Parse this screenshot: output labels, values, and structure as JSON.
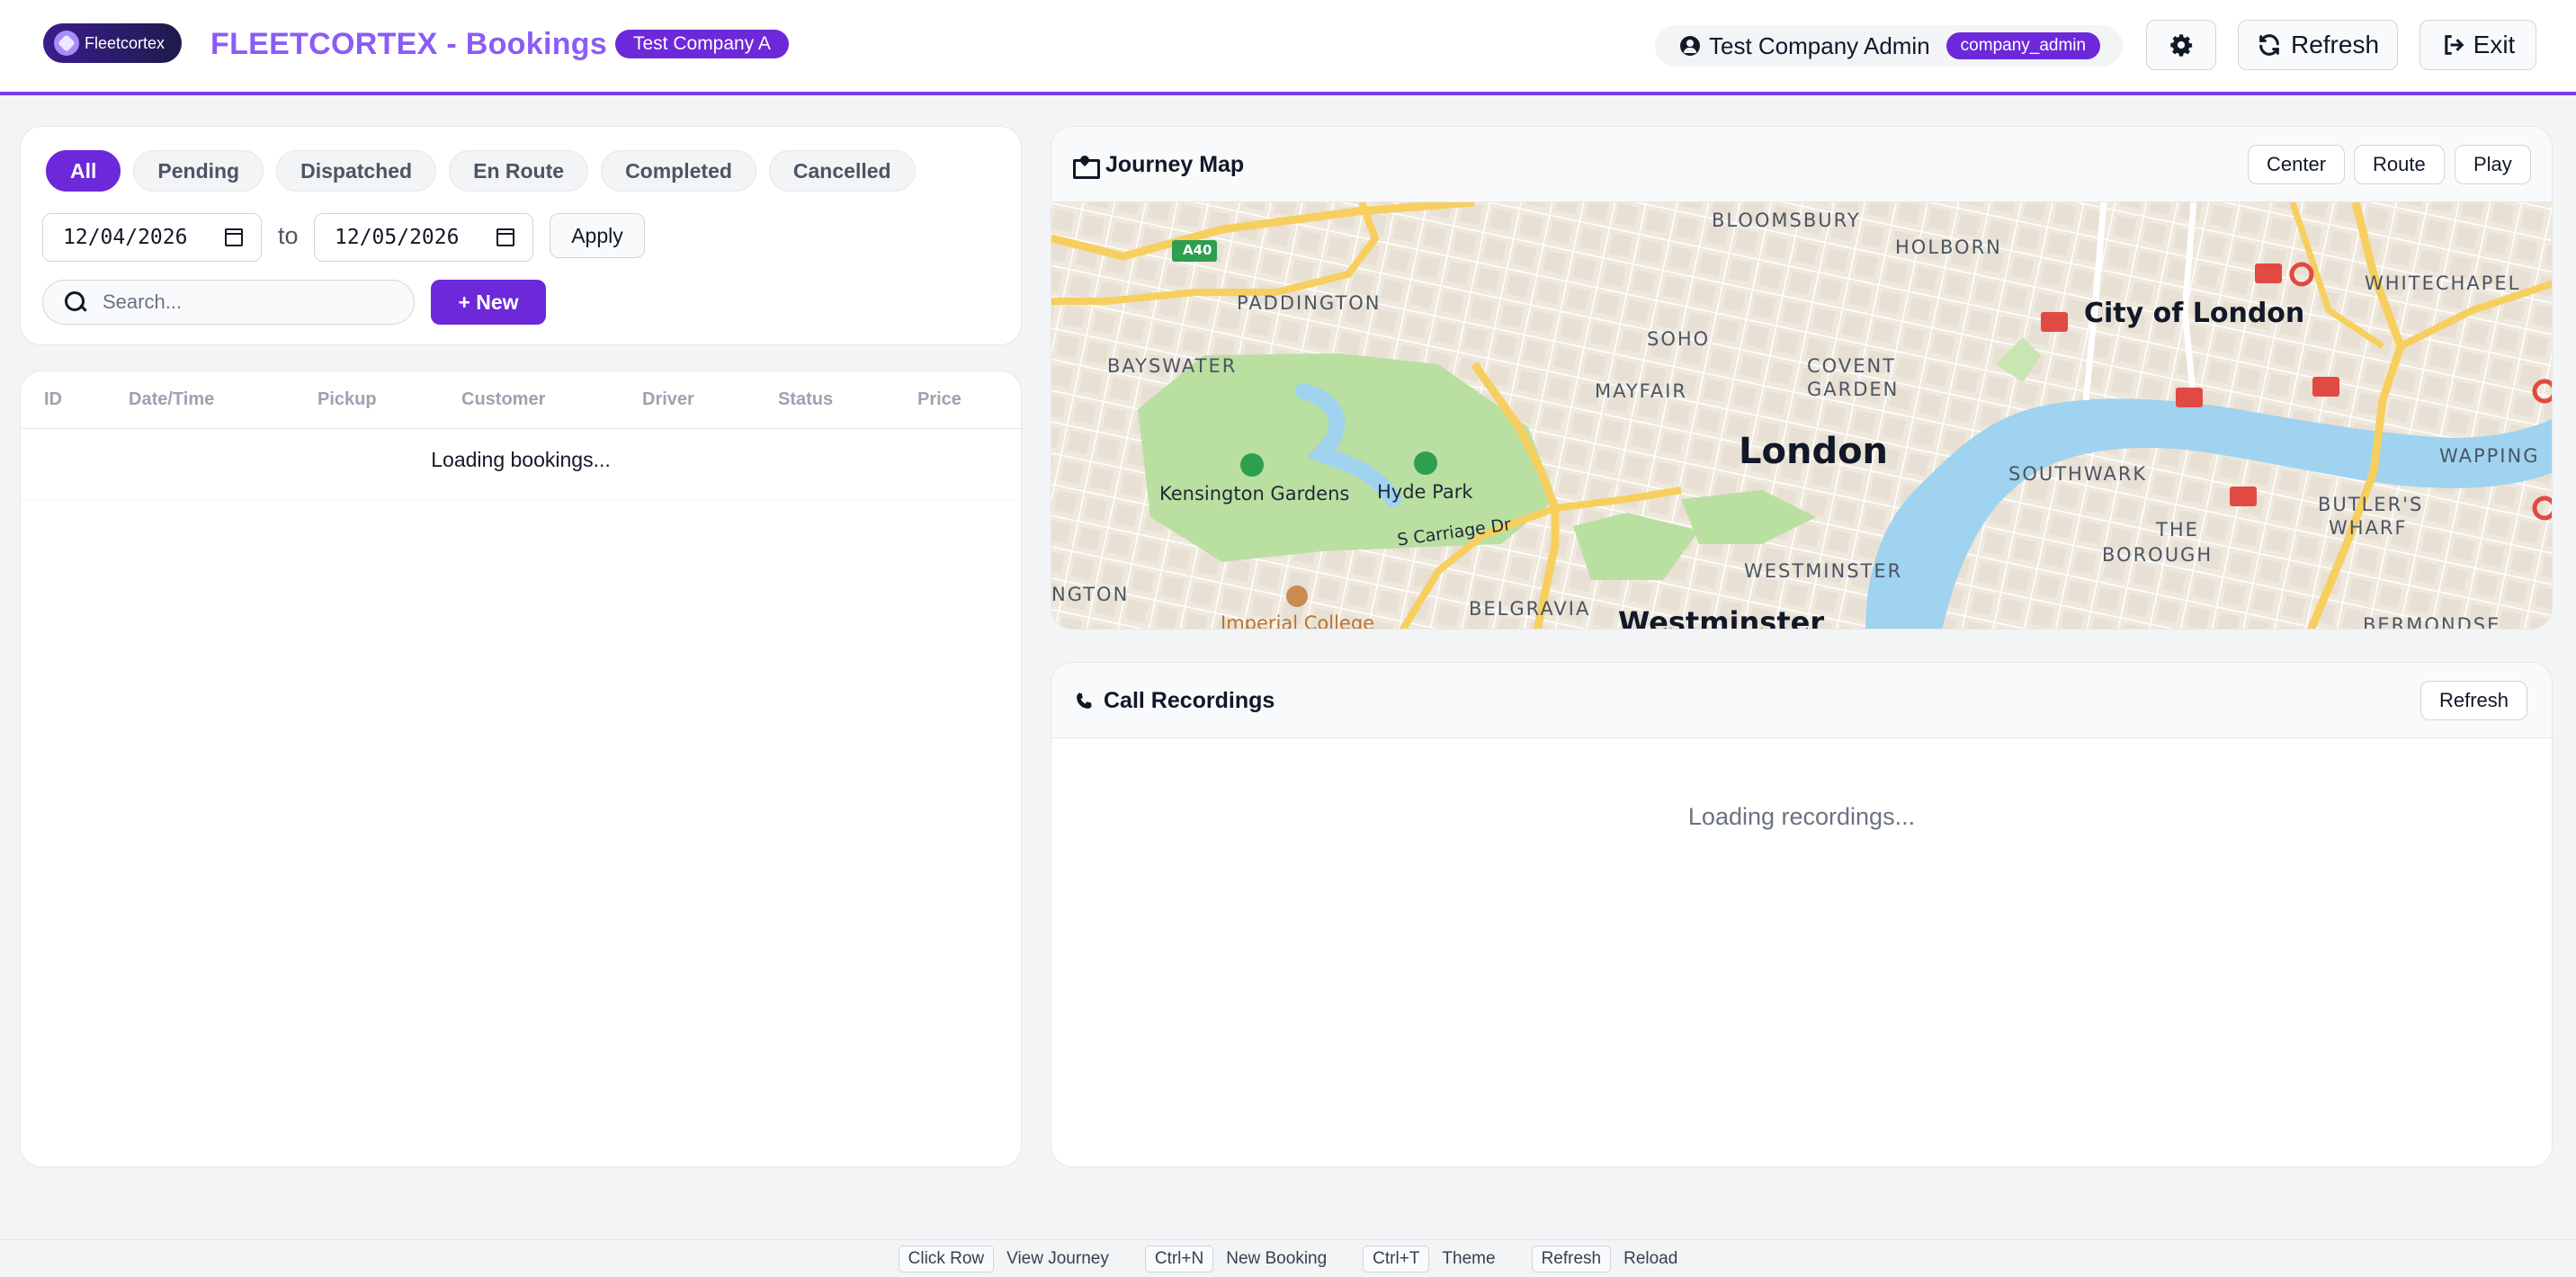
{
  "header": {
    "logo_text": "Fleetcortex",
    "title": "FLEETCORTEX - Bookings",
    "company": "Test Company A",
    "user_name": "Test Company Admin",
    "role": "company_admin",
    "refresh_label": "Refresh",
    "exit_label": "Exit",
    "icons": {
      "theme": "gear-icon",
      "refresh": "refresh-icon",
      "exit": "exit-icon",
      "user": "user-circle-icon"
    }
  },
  "filters": {
    "tabs": [
      {
        "label": "All",
        "active": true
      },
      {
        "label": "Pending",
        "active": false
      },
      {
        "label": "Dispatched",
        "active": false
      },
      {
        "label": "En Route",
        "active": false
      },
      {
        "label": "Completed",
        "active": false
      },
      {
        "label": "Cancelled",
        "active": false
      }
    ],
    "date_from": "12/04/2026",
    "date_to": "12/05/2026",
    "to_label": "to",
    "apply_label": "Apply",
    "search_placeholder": "Search...",
    "new_label": "New"
  },
  "bookings_table": {
    "columns": [
      "ID",
      "Date/Time",
      "Pickup",
      "Customer",
      "Driver",
      "Status",
      "Price"
    ],
    "loading_text": "Loading bookings..."
  },
  "journey_map": {
    "title": "Journey Map",
    "buttons": [
      "Center",
      "Route",
      "Play"
    ],
    "labels": {
      "bloomsbury": "BLOOMSBURY",
      "holborn": "HOLBORN",
      "whitechapel": "WHITECHAPEL",
      "paddington": "PADDINGTON",
      "city_of_london": "City of London",
      "soho": "SOHO",
      "bayswater": "BAYSWATER",
      "mayfair": "MAYFAIR",
      "covent_garden_1": "COVENT",
      "covent_garden_2": "GARDEN",
      "wapping": "WAPPING",
      "london": "London",
      "southwark": "SOUTHWARK",
      "butlers_wharf_1": "BUTLER'S",
      "butlers_wharf_2": "WHARF",
      "kensington_gardens": "Kensington Gardens",
      "hyde_park": "Hyde Park",
      "the_borough_1": "THE",
      "the_borough_2": "BOROUGH",
      "s_carriage_dr": "S Carriage Dr",
      "westminster_area": "WESTMINSTER",
      "kensington": "NGTON",
      "belgravia": "BELGRAVIA",
      "westminster": "Westminster",
      "imperial_college": "Imperial College",
      "bermondsey": "BERMONDSE",
      "a40": "A40"
    }
  },
  "call_recordings": {
    "title": "Call Recordings",
    "refresh_label": "Refresh",
    "loading_text": "Loading recordings..."
  },
  "footer": {
    "shortcuts": [
      {
        "key": "Click Row",
        "desc": "View Journey"
      },
      {
        "key": "Ctrl+N",
        "desc": "New Booking"
      },
      {
        "key": "Ctrl+T",
        "desc": "Theme"
      },
      {
        "key": "Refresh",
        "desc": "Reload"
      }
    ]
  },
  "colors": {
    "accent": "#6d28d9",
    "title": "#8b5cf6",
    "map_water": "#9fd3f0",
    "map_park": "#b9dfa1",
    "map_road_major": "#f7cf5e"
  }
}
